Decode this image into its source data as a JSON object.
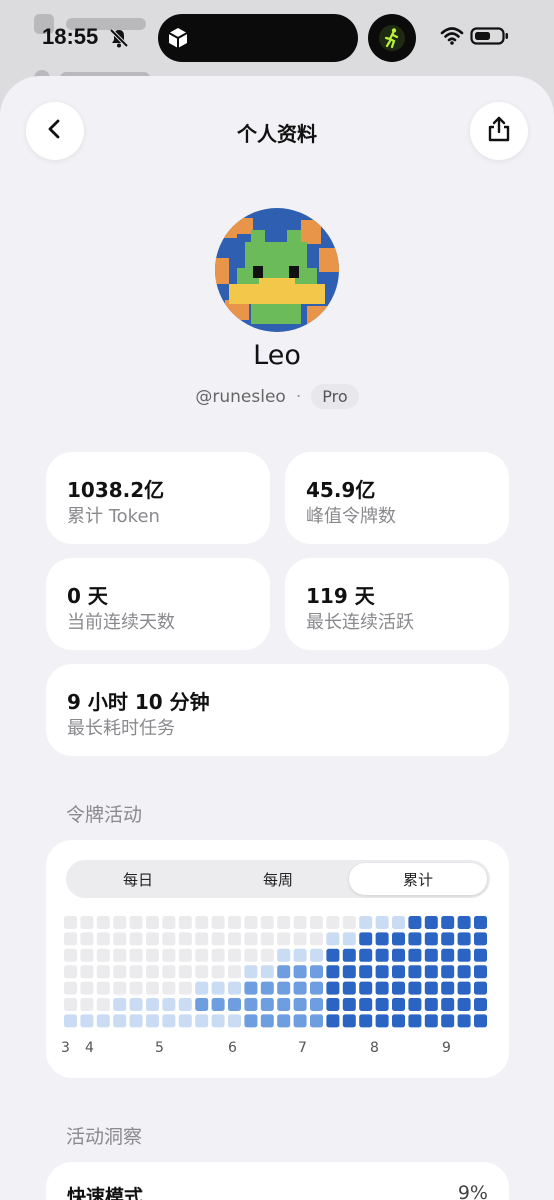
{
  "status_bar": {
    "time": "18:55"
  },
  "header": {
    "title": "个人资料",
    "back_icon": "chevron-left-icon",
    "share_icon": "share-icon"
  },
  "profile": {
    "name": "Leo",
    "handle": "@runesleo",
    "separator": "·",
    "plan_badge": "Pro"
  },
  "stats": [
    {
      "value": "1038.2亿",
      "label": "累计 Token"
    },
    {
      "value": "45.9亿",
      "label": "峰值令牌数"
    },
    {
      "value": "0 天",
      "label": "当前连续天数"
    },
    {
      "value": "119 天",
      "label": "最长连续活跃"
    },
    {
      "value": "9 小时 10 分钟",
      "label": "最长耗时任务"
    }
  ],
  "token_activity": {
    "title": "令牌活动",
    "tabs": [
      "每日",
      "每周",
      "累计"
    ],
    "active_tab": "累计",
    "columns": 26,
    "rows": 7,
    "column_levels": [
      0,
      0,
      0,
      1,
      1,
      1,
      1,
      1,
      2,
      2,
      2,
      3,
      3,
      4,
      4,
      4,
      5,
      5,
      6,
      6,
      6,
      7,
      7,
      7,
      7,
      7
    ],
    "month_labels": [
      "3",
      "4",
      "5",
      "6",
      "7",
      "8",
      "9"
    ],
    "colors": {
      "empty": "#ebebee",
      "level_1": "#c9dcf4",
      "level_2": "#6f9ee0",
      "level_3": "#2b64c2"
    }
  },
  "activity_insights": {
    "title": "活动洞察",
    "items": [
      {
        "label": "快速模式",
        "value": "9%"
      }
    ]
  }
}
